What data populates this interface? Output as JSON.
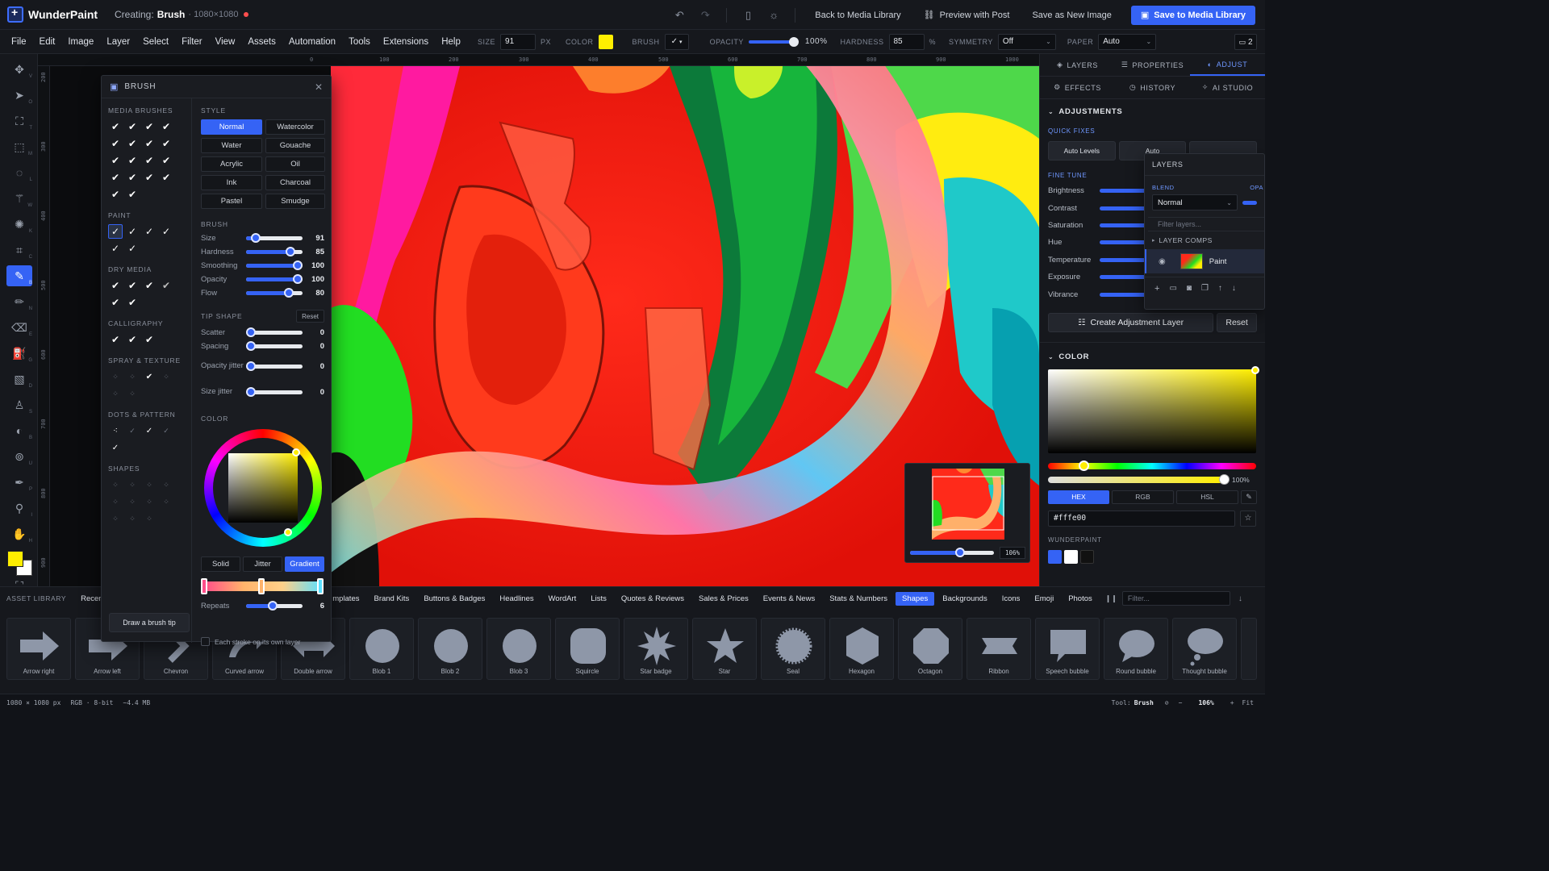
{
  "app": {
    "name": "WunderPaint",
    "creating_label": "Creating:",
    "doc_type": "Brush",
    "doc_size": "· 1080×1080"
  },
  "top_actions": {
    "back": "Back to Media Library",
    "preview": "Preview with Post",
    "save_new": "Save as New Image",
    "save_primary": "Save to Media Library"
  },
  "menu": [
    "File",
    "Edit",
    "Image",
    "Layer",
    "Select",
    "Filter",
    "View",
    "Assets",
    "Automation",
    "Tools",
    "Extensions",
    "Help"
  ],
  "options": {
    "size_label": "SIZE",
    "size_value": "91",
    "size_unit": "PX",
    "color_label": "COLOR",
    "color_value": "#ffee00",
    "brush_label": "BRUSH",
    "opacity_label": "OPACITY",
    "opacity_value": "100%",
    "hardness_label": "HARDNESS",
    "hardness_value": "85",
    "hardness_unit": "%",
    "symmetry_label": "SYMMETRY",
    "symmetry_value": "Off",
    "paper_label": "PAPER",
    "paper_value": "Auto",
    "panels_count": "2"
  },
  "ruler": {
    "top": [
      "0",
      "100",
      "200",
      "300",
      "400",
      "500",
      "600",
      "700",
      "800",
      "900",
      "1000"
    ],
    "left": [
      "200",
      "300",
      "400",
      "500",
      "600",
      "700",
      "800",
      "900"
    ]
  },
  "brush_panel": {
    "title": "BRUSH",
    "media_label": "MEDIA BRUSHES",
    "paint_label": "PAINT",
    "dry_label": "DRY MEDIA",
    "calligraphy_label": "CALLIGRAPHY",
    "spray_label": "SPRAY & TEXTURE",
    "dots_label": "DOTS & PATTERN",
    "shapes_label": "SHAPES",
    "draw_tip": "Draw a brush tip",
    "style_label": "STYLE",
    "styles": [
      "Normal",
      "Watercolor",
      "Water",
      "Gouache",
      "Acrylic",
      "Oil",
      "Ink",
      "Charcoal",
      "Pastel",
      "Smudge"
    ],
    "brush_label": "BRUSH",
    "sliders": [
      {
        "label": "Size",
        "value": "91",
        "level": 0.17
      },
      {
        "label": "Hardness",
        "value": "85",
        "level": 0.78
      },
      {
        "label": "Smoothing",
        "value": "100",
        "level": 0.92
      },
      {
        "label": "Opacity",
        "value": "100",
        "level": 0.92
      },
      {
        "label": "Flow",
        "value": "80",
        "level": 0.75
      }
    ],
    "tip_label": "TIP SHAPE",
    "reset": "Reset",
    "tip_sliders": [
      {
        "label": "Scatter",
        "value": "0"
      },
      {
        "label": "Spacing",
        "value": "0"
      },
      {
        "label": "Opacity jitter",
        "value": "0"
      },
      {
        "label": "Size jitter",
        "value": "0"
      }
    ],
    "color_label": "COLOR",
    "modes": [
      "Solid",
      "Jitter",
      "Gradient"
    ],
    "repeats_label": "Repeats",
    "repeats_value": "6",
    "own_layer": "Each stroke on its own layer"
  },
  "right_panel": {
    "tabs": [
      "LAYERS",
      "PROPERTIES",
      "ADJUST"
    ],
    "tabs2": [
      "EFFECTS",
      "HISTORY",
      "AI STUDIO"
    ],
    "adjustments_title": "ADJUSTMENTS",
    "quick_fixes": "QUICK FIXES",
    "qf_buttons": [
      "Auto Levels",
      "Auto"
    ],
    "fine_tune": "FINE TUNE",
    "fine_items": [
      "Brightness",
      "Contrast",
      "Saturation",
      "Hue",
      "Temperature",
      "Exposure",
      "Vibrance"
    ],
    "create_adj": "Create Adjustment Layer",
    "reset": "Reset",
    "color_title": "COLOR",
    "alpha_value": "100%",
    "color_modes": [
      "HEX",
      "RGB",
      "HSL"
    ],
    "hex_value": "#fffe00",
    "palette_label": "WUNDERPAINT",
    "palette_colors": [
      "#3563f5",
      "#ffffff",
      "#111111"
    ]
  },
  "layers_float": {
    "title": "LAYERS",
    "blend_label": "BLEND",
    "opacity_label": "OPA",
    "blend_value": "Normal",
    "filter_placeholder": "Filter layers...",
    "comps": "LAYER COMPS",
    "layer_name": "Paint"
  },
  "navigator": {
    "zoom": "106%"
  },
  "assets": {
    "label": "ASSET LIBRARY",
    "tabs": [
      "Recent",
      "mplates",
      "Brand Kits",
      "Buttons & Badges",
      "Headlines",
      "WordArt",
      "Lists",
      "Quotes & Reviews",
      "Sales & Prices",
      "Events & News",
      "Stats & Numbers",
      "Shapes",
      "Backgrounds",
      "Icons",
      "Emoji",
      "Photos"
    ],
    "active_tab": "Shapes",
    "filter_placeholder": "Filter...",
    "items": [
      "Arrow right",
      "Arrow left",
      "Chevron",
      "Curved arrow",
      "Double arrow",
      "Blob 1",
      "Blob 2",
      "Blob 3",
      "Squircle",
      "Star badge",
      "Star",
      "Seal",
      "Hexagon",
      "Octagon",
      "Ribbon",
      "Speech bubble",
      "Round bubble",
      "Thought bubble"
    ]
  },
  "status": {
    "size": "1080 × 1080 px",
    "mode": "RGB · 8-bit",
    "mem": "~4.4 MB",
    "tool_label": "Tool:",
    "tool_value": "Brush",
    "zoom": "106%",
    "fit": "Fit"
  }
}
